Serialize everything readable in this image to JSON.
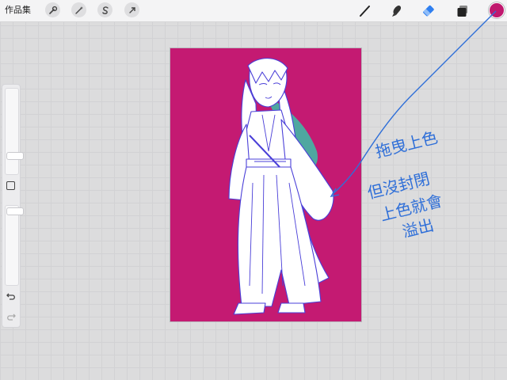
{
  "toolbar": {
    "gallery_label": "作品集",
    "left_tools": [
      {
        "name": "actions-wrench-icon"
      },
      {
        "name": "adjustments-wand-icon"
      },
      {
        "name": "selection-s-icon"
      },
      {
        "name": "transform-arrow-icon"
      }
    ],
    "right_tools": [
      {
        "name": "brush-icon"
      },
      {
        "name": "smudge-icon"
      },
      {
        "name": "eraser-icon",
        "active": true
      },
      {
        "name": "layers-icon"
      }
    ],
    "current_color": "#c0186e"
  },
  "sidebar": {
    "brush_size_level": 0.2,
    "opacity_level": 0.98,
    "undo_icon": "undo-arrow-icon",
    "redo_icon": "redo-arrow-icon"
  },
  "canvas": {
    "fill_color": "#c41a72",
    "line_color": "#4a3fd8",
    "accent_color": "#4fa7a0"
  },
  "annotation": {
    "color": "#2f6fd8",
    "lines": [
      "拖曳上色",
      "但沒封閉",
      "上色就會",
      "溢出"
    ]
  },
  "colors": {
    "accent_blue": "#2f7ff0",
    "toolbar_bg": "#f4f4f5",
    "canvas_bg": "#dcdcdd"
  }
}
